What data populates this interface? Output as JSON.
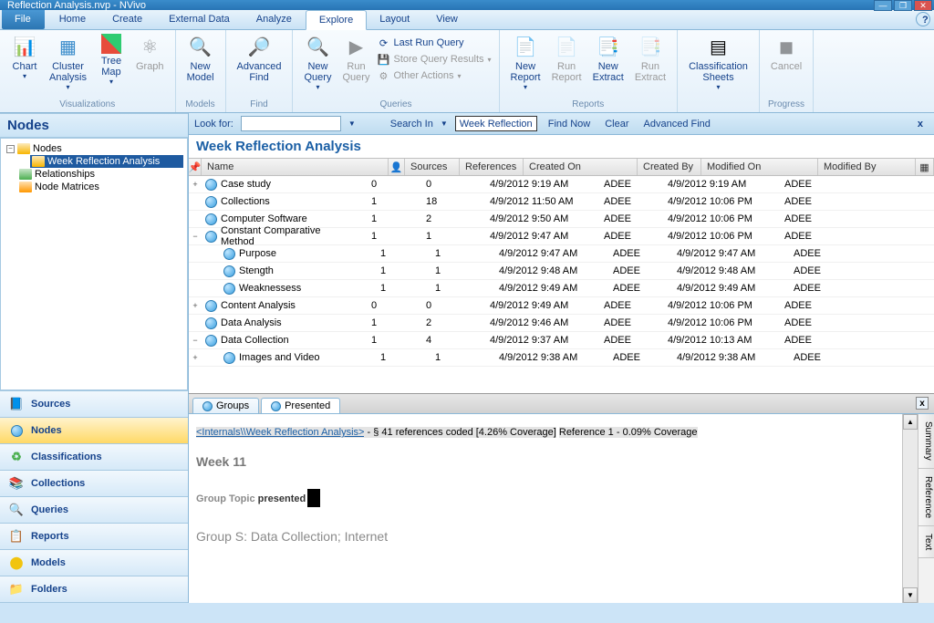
{
  "window": {
    "title": "Reflection Analysis.nvp - NVivo"
  },
  "tabs": {
    "file": "File",
    "home": "Home",
    "create": "Create",
    "external": "External Data",
    "analyze": "Analyze",
    "explore": "Explore",
    "layout": "Layout",
    "view": "View"
  },
  "ribbon": {
    "chart": "Chart",
    "cluster": "Cluster\nAnalysis",
    "treemap": "Tree\nMap",
    "graph": "Graph",
    "visualizations": "Visualizations",
    "newmodel": "New\nModel",
    "models": "Models",
    "advfind": "Advanced\nFind",
    "find": "Find",
    "newquery": "New\nQuery",
    "runquery": "Run\nQuery",
    "lastrun": "Last Run Query",
    "storeqr": "Store Query Results",
    "otheract": "Other Actions",
    "queries": "Queries",
    "newreport": "New\nReport",
    "runreport": "Run\nReport",
    "newextract": "New\nExtract",
    "runextract": "Run\nExtract",
    "reports": "Reports",
    "classsheets": "Classification\nSheets",
    "cancel": "Cancel",
    "progress": "Progress"
  },
  "navtitle": "Nodes",
  "tree": {
    "nodes": "Nodes",
    "wra": "Week Reflection Analysis",
    "relationships": "Relationships",
    "matrices": "Node Matrices"
  },
  "accordion": {
    "sources": "Sources",
    "nodes": "Nodes",
    "classifications": "Classifications",
    "collections": "Collections",
    "queries": "Queries",
    "reports": "Reports",
    "models": "Models",
    "folders": "Folders"
  },
  "findbar": {
    "lookfor": "Look for:",
    "searchin": "Search In",
    "combo": "Week Reflection",
    "findnow": "Find Now",
    "clear": "Clear",
    "advfind": "Advanced Find"
  },
  "doctitle": "Week Reflection Analysis",
  "grid": {
    "headers": {
      "name": "Name",
      "sources": "Sources",
      "references": "References",
      "createdon": "Created On",
      "createdby": "Created By",
      "modifiedon": "Modified On",
      "modifiedby": "Modified By"
    },
    "rows": [
      {
        "exp": "+",
        "ind": 0,
        "name": "Case study",
        "src": "0",
        "ref": "0",
        "con": "4/9/2012 9:19 AM",
        "cby": "ADEE",
        "mon": "4/9/2012 9:19 AM",
        "mby": "ADEE"
      },
      {
        "exp": "",
        "ind": 0,
        "name": "Collections",
        "src": "1",
        "ref": "18",
        "con": "4/9/2012 11:50 AM",
        "cby": "ADEE",
        "mon": "4/9/2012 10:06 PM",
        "mby": "ADEE"
      },
      {
        "exp": "",
        "ind": 0,
        "name": "Computer Software",
        "src": "1",
        "ref": "2",
        "con": "4/9/2012 9:50 AM",
        "cby": "ADEE",
        "mon": "4/9/2012 10:06 PM",
        "mby": "ADEE"
      },
      {
        "exp": "−",
        "ind": 0,
        "name": "Constant Comparative Method",
        "src": "1",
        "ref": "1",
        "con": "4/9/2012 9:47 AM",
        "cby": "ADEE",
        "mon": "4/9/2012 10:06 PM",
        "mby": "ADEE"
      },
      {
        "exp": "",
        "ind": 1,
        "name": "Purpose",
        "src": "1",
        "ref": "1",
        "con": "4/9/2012 9:47 AM",
        "cby": "ADEE",
        "mon": "4/9/2012 9:47 AM",
        "mby": "ADEE"
      },
      {
        "exp": "",
        "ind": 1,
        "name": "Stength",
        "src": "1",
        "ref": "1",
        "con": "4/9/2012 9:48 AM",
        "cby": "ADEE",
        "mon": "4/9/2012 9:48 AM",
        "mby": "ADEE"
      },
      {
        "exp": "",
        "ind": 1,
        "name": "Weaknessess",
        "src": "1",
        "ref": "1",
        "con": "4/9/2012 9:49 AM",
        "cby": "ADEE",
        "mon": "4/9/2012 9:49 AM",
        "mby": "ADEE"
      },
      {
        "exp": "+",
        "ind": 0,
        "name": "Content Analysis",
        "src": "0",
        "ref": "0",
        "con": "4/9/2012 9:49 AM",
        "cby": "ADEE",
        "mon": "4/9/2012 10:06 PM",
        "mby": "ADEE"
      },
      {
        "exp": "",
        "ind": 0,
        "name": "Data Analysis",
        "src": "1",
        "ref": "2",
        "con": "4/9/2012 9:46 AM",
        "cby": "ADEE",
        "mon": "4/9/2012 10:06 PM",
        "mby": "ADEE"
      },
      {
        "exp": "−",
        "ind": 0,
        "name": "Data Collection",
        "src": "1",
        "ref": "4",
        "con": "4/9/2012 9:37 AM",
        "cby": "ADEE",
        "mon": "4/9/2012 10:13 AM",
        "mby": "ADEE"
      },
      {
        "exp": "+",
        "ind": 1,
        "name": "Images and Video",
        "src": "1",
        "ref": "1",
        "con": "4/9/2012 9:38 AM",
        "cby": "ADEE",
        "mon": "4/9/2012 9:38 AM",
        "mby": "ADEE"
      }
    ]
  },
  "detailtabs": {
    "groups": "Groups",
    "presented": "Presented"
  },
  "detail": {
    "link": "<Internals\\\\Week Reflection Analysis>",
    "meta": " - § 41 references coded  [4.26% Coverage]",
    "ref1": "Reference 1 - 0.09% Coverage",
    "week": "Week 11",
    "gt1": "Group Topic ",
    "gt2": "presented",
    "gs": "Group S: Data Collection; Internet"
  },
  "sidetabs": {
    "summary": "Summary",
    "reference": "Reference",
    "text": "Text"
  }
}
